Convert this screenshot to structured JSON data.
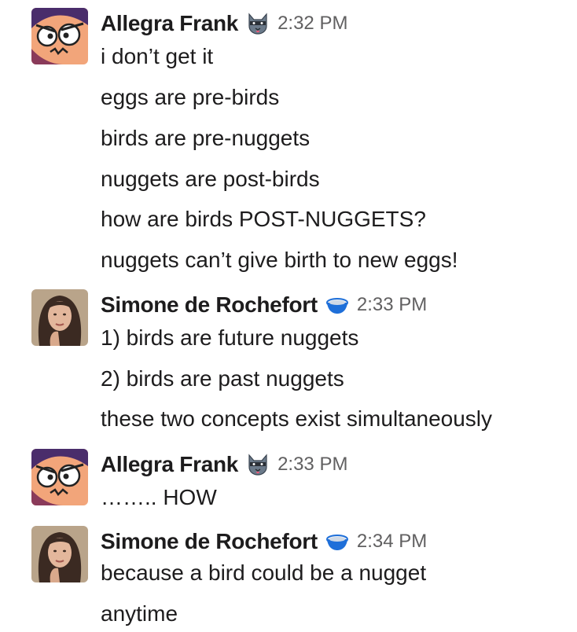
{
  "messages": [
    {
      "sender": "Allegra Frank",
      "status_icon": "cat-status-icon",
      "time": "2:32 PM",
      "lines": [
        "i don’t get it",
        "eggs are pre-birds",
        "birds are pre-nuggets",
        "nuggets are post-birds",
        "how are birds POST-NUGGETS?",
        "nuggets can’t give birth to new eggs!"
      ]
    },
    {
      "sender": "Simone de Rochefort",
      "status_icon": "bowl-status-icon",
      "time": "2:33 PM",
      "lines": [
        "1) birds are future nuggets",
        "2) birds are past nuggets",
        "these two concepts exist simultaneously"
      ]
    },
    {
      "sender": "Allegra Frank",
      "status_icon": "cat-status-icon",
      "time": "2:33 PM",
      "lines": [
        "…….. HOW"
      ]
    },
    {
      "sender": "Simone de Rochefort",
      "status_icon": "bowl-status-icon",
      "time": "2:34 PM",
      "lines": [
        "because a bird could be a nugget",
        "anytime"
      ]
    }
  ],
  "colors": {
    "text": "#1d1c1d",
    "timestamp": "#616061",
    "bowl_blue": "#1e6fd9"
  }
}
